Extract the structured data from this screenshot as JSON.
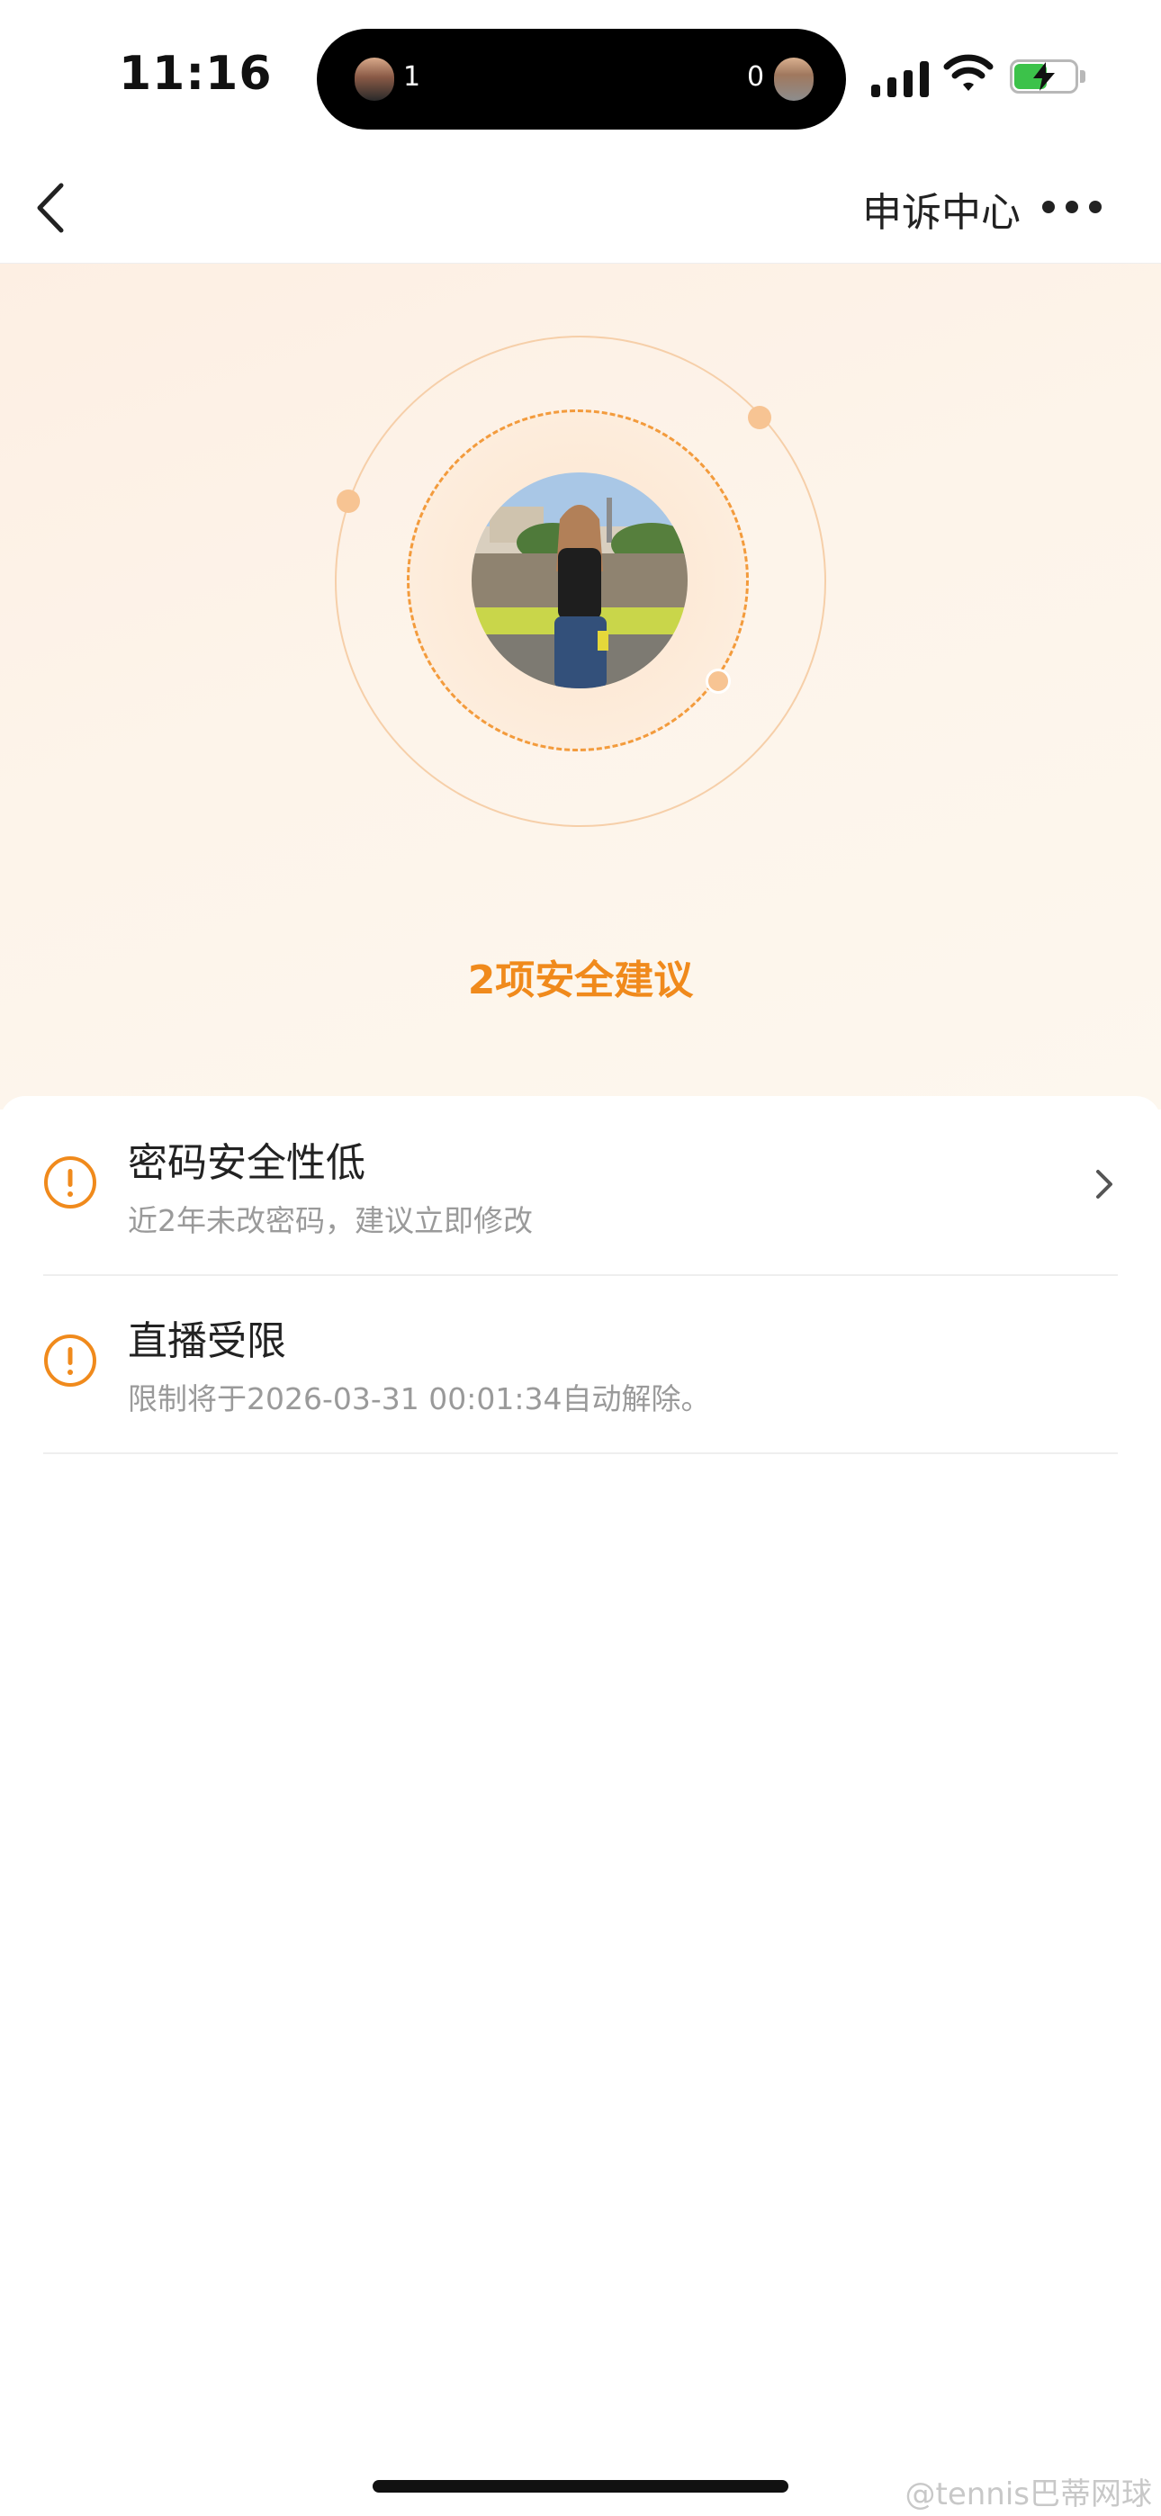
{
  "status_bar": {
    "time": "11:16",
    "island_left_count": "1",
    "island_right_count": "0",
    "icons": [
      "cellular-signal-icon",
      "wifi-icon",
      "battery-charging-icon"
    ],
    "battery_fill_fraction": 0.55,
    "battery_color": "#3cc24a"
  },
  "nav": {
    "back_icon": "chevron-left-icon",
    "title": "申诉中心",
    "more_icon": "more-dots-icon"
  },
  "hero": {
    "title": "2项安全建议",
    "accent_color": "#f08a1c"
  },
  "items": [
    {
      "icon": "warning-icon",
      "title": "密码安全性低",
      "subtitle": "近2年未改密码，建议立即修改",
      "has_chevron": true
    },
    {
      "icon": "warning-icon",
      "title": "直播受限",
      "subtitle": "限制将于2026-03-31 00:01:34自动解除。",
      "has_chevron": false
    }
  ],
  "watermark": "@tennis巴蒂网球"
}
